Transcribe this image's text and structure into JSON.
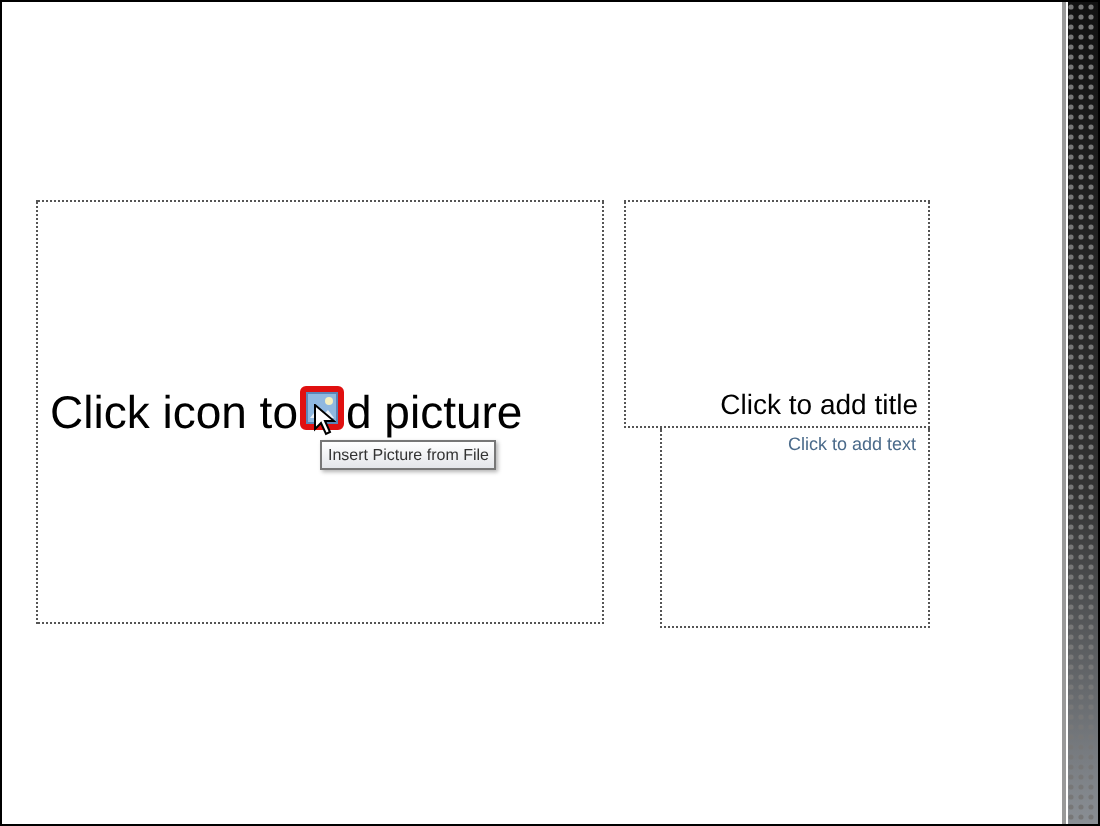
{
  "picture_placeholder": {
    "text_before_icon": "Click icon to",
    "text_after_icon": "d picture",
    "icon_hovered": true,
    "tooltip": "Insert Picture from File"
  },
  "title_placeholder": {
    "text": "Click to add title"
  },
  "text_placeholder": {
    "text": "Click to add text"
  }
}
